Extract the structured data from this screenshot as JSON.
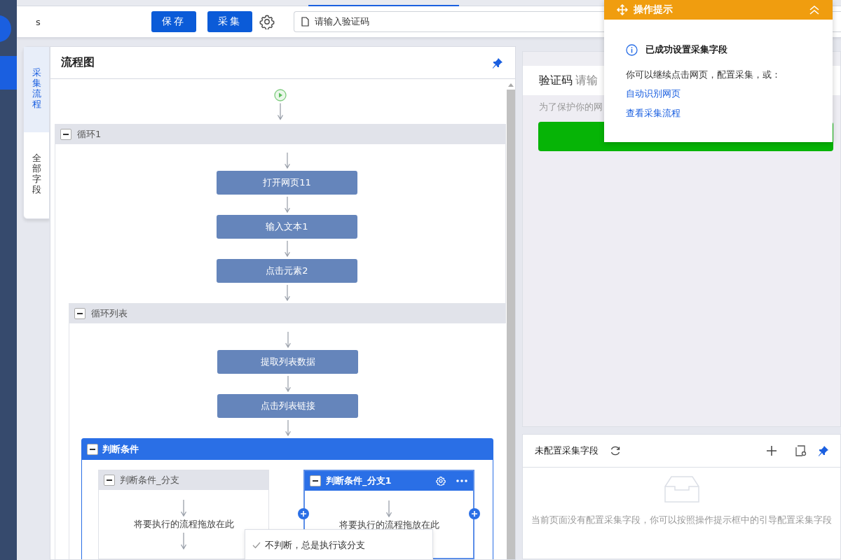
{
  "toolbar": {
    "task_name": "s",
    "buttons": [
      "保存",
      "采集"
    ],
    "address": "请输入验证码"
  },
  "side_tabs": [
    {
      "label": "采集流程",
      "selected": true
    },
    {
      "label": "全部字段",
      "selected": false
    }
  ],
  "flow_panel": {
    "title": "流程图",
    "loop": {
      "title": "循环1",
      "steps": [
        "打开网页11",
        "输入文本1",
        "点击元素2"
      ],
      "inner_loop": {
        "title": "循环列表",
        "steps": [
          "提取列表数据",
          "点击列表链接"
        ],
        "condition": {
          "title": "判断条件",
          "branches": [
            {
              "title": "判断条件_分支",
              "selected": false,
              "hint": "将要执行的流程拖放在此"
            },
            {
              "title": "判断条件_分支1",
              "selected": true,
              "hint": "将要执行的流程拖放在此"
            }
          ]
        }
      }
    },
    "dropdown": {
      "options": [
        {
          "label": "不判断，总是执行该分支",
          "checked": true
        }
      ]
    }
  },
  "page_preview": {
    "label": "验证码",
    "input_hint": "请输",
    "notice": "为了保护你的网"
  },
  "fields_panel": {
    "title": "未配置采集字段",
    "empty_text": "当前页面没有配置采集字段，你可以按照操作提示框中的引导配置采集字段"
  },
  "tip_popup": {
    "title": "操作提示",
    "heading": "已成功设置采集字段",
    "text": "你可以继续点击网页，配置采集，或：",
    "links": [
      "自动识别网页",
      "查看采集流程"
    ]
  }
}
